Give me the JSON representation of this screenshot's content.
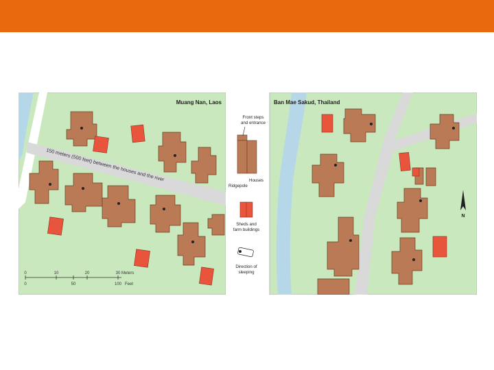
{
  "colors": {
    "accent_bar": "#e8690e",
    "land": "#c9e8bd",
    "river": "#b5d7e8",
    "road": "#d9d9d9",
    "house": "#b97a55",
    "house_line": "#6b3e22",
    "shed": "#e8553c",
    "legend_bg": "#ffffff"
  },
  "left_map": {
    "title": "Muang Nan, Laos",
    "road_label": "150 meters (500 feet) between the houses and the river"
  },
  "right_map": {
    "title": "Ban Mae Sakud, Thailand",
    "north_label": "N",
    "north_icon": "north-arrow-icon"
  },
  "legend": {
    "front_steps": "Front steps and entrance",
    "houses": "Houses",
    "ridgepole": "Ridgepole",
    "sheds": "Sheds and farm buildings",
    "sleeping": "Direction of sleeping"
  },
  "scale": {
    "meters_ticks": [
      "0",
      "10",
      "20",
      "30"
    ],
    "meters_unit": "Meters",
    "feet_ticks": [
      "0",
      "50",
      "100"
    ],
    "feet_unit": "Feet"
  }
}
